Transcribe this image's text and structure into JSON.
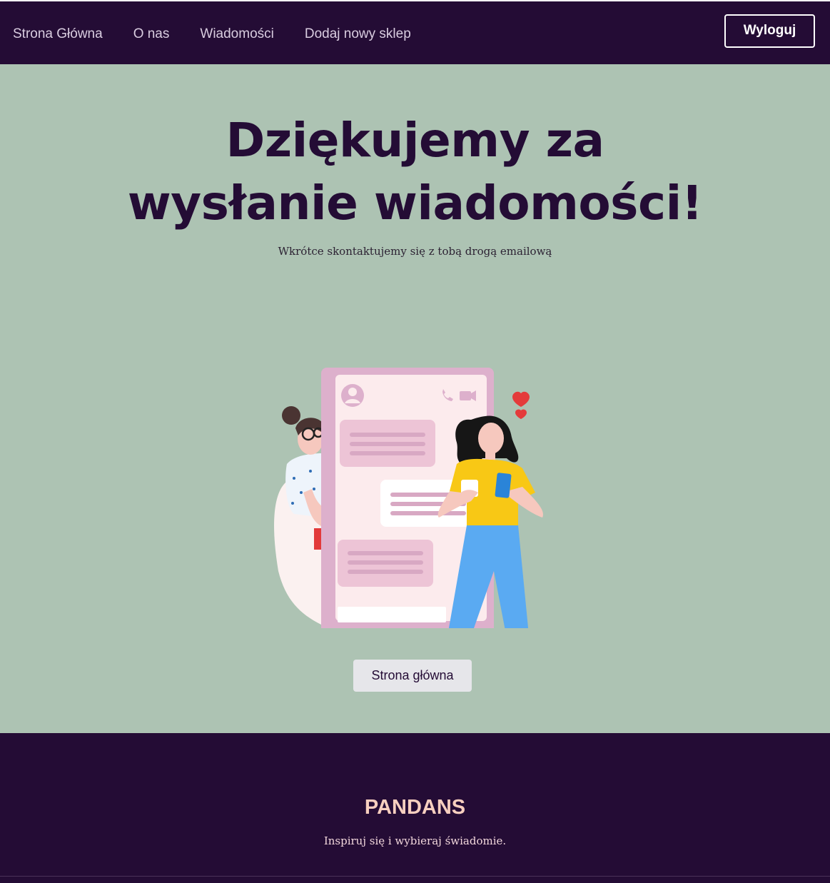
{
  "nav": {
    "links": [
      {
        "label": "Strona Główna"
      },
      {
        "label": "O nas"
      },
      {
        "label": "Wiadomości"
      },
      {
        "label": "Dodaj nowy sklep"
      }
    ],
    "logout_label": "Wyloguj"
  },
  "hero": {
    "title": "Dziękujemy za wysłanie wiadomości!",
    "subtitle": "Wkrótce skontaktujemy się z tobą drogą emailową",
    "home_button_label": "Strona główna"
  },
  "footer": {
    "brand": "PANDANS",
    "tagline": "Inspiruj się i wybieraj świadomie."
  },
  "colors": {
    "nav_bg": "#240c35",
    "hero_bg": "#adc3b3",
    "brand_accent": "#f7cfbf"
  }
}
